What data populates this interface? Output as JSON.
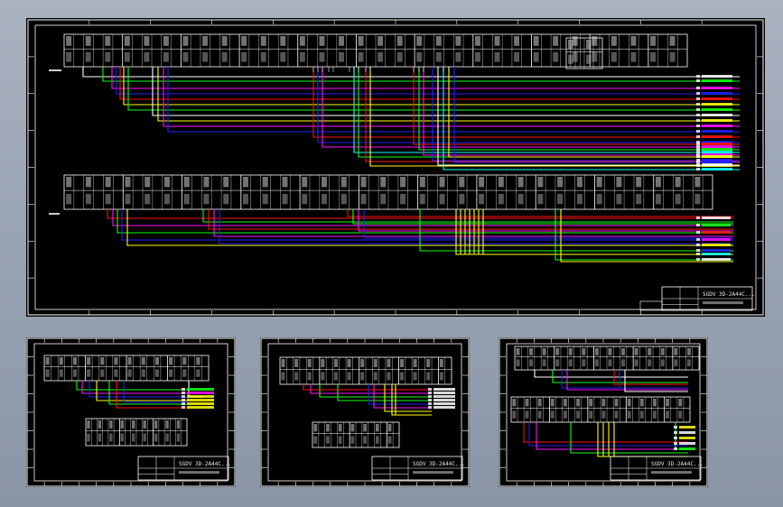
{
  "colors": {
    "background": "#9aa4b3",
    "sheet": "#000000",
    "frame": "#ffffff",
    "wire_red": "#ff1010",
    "wire_green": "#10ff10",
    "wire_blue": "#2020ff",
    "wire_magenta": "#ff10ff",
    "wire_yellow": "#ffff10",
    "wire_cyan": "#10ffff",
    "wire_white": "#ffffff"
  },
  "sheets": [
    {
      "name": "main-wiring-sheet",
      "title_block": "SGDV 3D-2A44C..."
    },
    {
      "name": "detail-sheet-1",
      "title_block": "SGDV 3D-2A44C..."
    },
    {
      "name": "detail-sheet-2",
      "title_block": "SGDV 3D-2A44C..."
    },
    {
      "name": "detail-sheet-3",
      "title_block": "SGDV 3D-2A44C..."
    }
  ]
}
